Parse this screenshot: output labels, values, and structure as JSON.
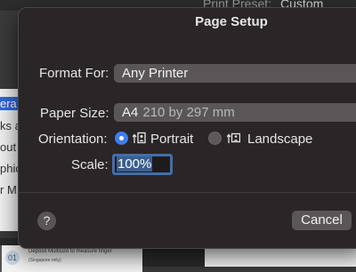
{
  "background": {
    "print_preset_label": "Print Preset:",
    "print_preset_value": "Custom",
    "sidebar_fragments": [
      "era",
      "ks a",
      "out",
      "phic",
      "r M"
    ],
    "doc_number": "01",
    "doc_line1": "Deposit Multisize to measure finger",
    "doc_line2": "(Singapore only)"
  },
  "dialog": {
    "title": "Page Setup",
    "format_for_label": "Format For:",
    "format_for_value": "Any Printer",
    "paper_size_label": "Paper Size:",
    "paper_size_value": "A4",
    "paper_size_detail": "210 by 297 mm",
    "orientation_label": "Orientation:",
    "portrait_label": "Portrait",
    "landscape_label": "Landscape",
    "selected_orientation": "Portrait",
    "scale_label": "Scale:",
    "scale_value": "100%",
    "help_label": "?",
    "cancel_label": "Cancel"
  },
  "colors": {
    "accent": "#3d7ef0",
    "dialog_bg": "#2a2527",
    "popup_bg": "#5a5657"
  }
}
